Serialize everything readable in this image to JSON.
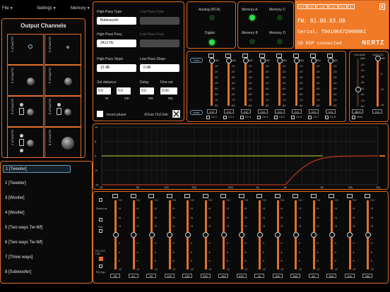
{
  "menu": {
    "file": "File",
    "settings": "Settings",
    "memory": "Memory",
    "caret": "▼"
  },
  "outputs": {
    "title": "Output Channels",
    "cells": [
      "OUTPUT 1",
      "OUTPUT 2",
      "OUTPUT 3",
      "OUTPUT 4",
      "OUTPUT 5",
      "OUTPUT 6",
      "OUTPUT 7",
      "OUTPUT 8"
    ]
  },
  "channels": [
    "1 [Tweeter]",
    "2 [Tweeter]",
    "3 [Woofer]",
    "4 [Woofer]",
    "5 [Two ways Tw-Wf]",
    "6 [Two ways Tw-Wf]",
    "7 [Three ways]",
    "8 [Subwoofer]"
  ],
  "crossover": {
    "hp_type_label": "High-Pass Type",
    "hp_type": "Butterworth",
    "lp_type_label": "Low-Pass Type",
    "lp_type": "------",
    "hp_freq_label": "High-Pass Freq.",
    "hp_freq": "3412 Hz",
    "lp_freq_label": "Low-Pass Freq.",
    "lp_freq": "------",
    "hp_slope_label": "High-Pass Slope",
    "hp_slope": "12 dB",
    "lp_slope_label": "Low-Pass Slope",
    "lp_slope": "0 dB",
    "set_distance_label": "Set distance",
    "distance_value": "0.0",
    "distance_unit": "m",
    "distance2_value": "0.0",
    "distance2_unit": "cm",
    "delay_label": "Delay",
    "delay_value": "0.0",
    "delay_unit": "ms",
    "fine_label": "Fine set",
    "fine_value": "0.00",
    "fine_unit": "ms",
    "invert_label": "Invert phase",
    "xover_label": "XOver Ch2 link"
  },
  "inputs": {
    "analog": "Analog (RCA)",
    "digital": "Digital"
  },
  "memory": {
    "a": "Memory A",
    "b": "Memory B",
    "c": "Memory C",
    "d": "Memory D"
  },
  "device": {
    "tags": [
      "DSP",
      "HRT",
      "0-80",
      "LIM",
      "DIG",
      "IN"
    ],
    "fw": "FW: 01.00.03.00",
    "serial": "Serial: T00106472000001",
    "status": "S8 DSP connected",
    "brand": "NERTZ"
  },
  "mixer": {
    "solo_label": "Solo",
    "mute_label": "Mute",
    "scale": [
      "0dB",
      "-10",
      "-20",
      "-30",
      "-40",
      "-50",
      "-60",
      "-70",
      "-80"
    ],
    "channels": [
      {
        "label": "Ch 1",
        "value": "0.0",
        "level": 1.0
      },
      {
        "label": "Ch 2",
        "value": "0.0",
        "level": 1.0
      },
      {
        "label": "Ch 3",
        "value": "0.0",
        "level": 1.0
      },
      {
        "label": "Ch 4",
        "value": "0.0",
        "level": 1.0
      },
      {
        "label": "Ch 5",
        "value": "0.0",
        "level": 1.0
      },
      {
        "label": "Ch 6",
        "value": "0.0",
        "level": 1.0
      },
      {
        "label": "Ch 7",
        "value": "0.0",
        "level": 1.0
      },
      {
        "label": "Ch 8",
        "value": "0.0",
        "level": 1.0
      }
    ],
    "master_label": "VOLUME",
    "sub_label": "SUB VOL",
    "master_value": "-80.0",
    "sub_value": "0.0",
    "sub_scale": [
      "0dB",
      "-5",
      "-10",
      "-15"
    ],
    "mute_all": "Mute"
  },
  "response": {
    "y_ticks": [
      "10",
      "5",
      "0",
      "-5",
      "-10"
    ],
    "x_ticks": [
      "20",
      "50",
      "100",
      "200",
      "500",
      "1k",
      "2k",
      "5k",
      "10k",
      "20k"
    ]
  },
  "eq": {
    "select_all": "Select all",
    "flat": "Flat",
    "eq_link": "EQ Ch2 Link",
    "eq_by": "EQ byp.",
    "scale": [
      "+12",
      "+9",
      "+6",
      "+3",
      "0",
      "-3",
      "-6",
      "-9",
      "-12"
    ],
    "bands": [
      "25",
      "40",
      "63",
      "100",
      "160",
      "250",
      "400",
      "630",
      "1k",
      "1k6",
      "2k5",
      "4k",
      "6k3",
      "10k",
      "16k"
    ]
  },
  "colors": {
    "accent": "#e0702a",
    "device_bg": "#f07a28",
    "led_on": "#2ee04a",
    "curve_hp": "#e8401e",
    "curve_flat": "#c8d830"
  }
}
